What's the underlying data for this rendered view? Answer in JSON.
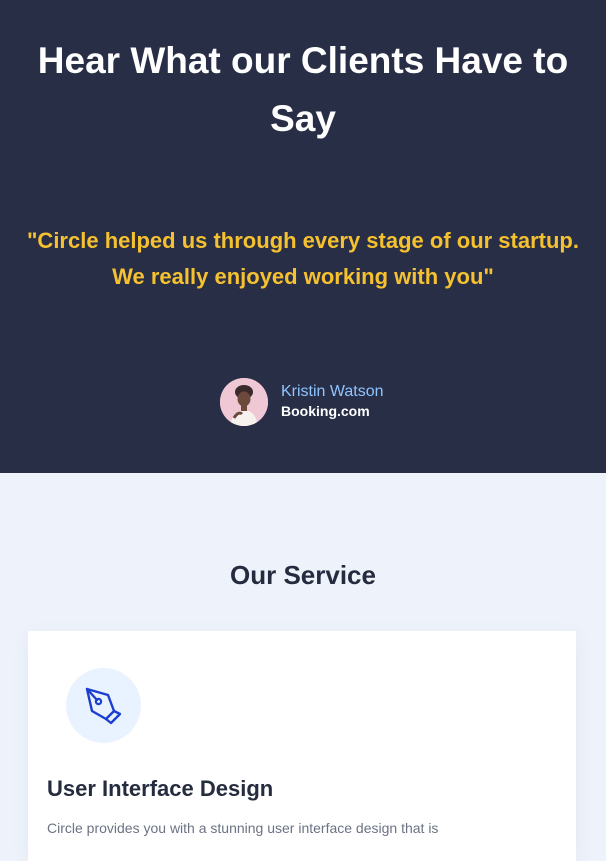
{
  "testimonial": {
    "heading": "Hear What our Clients Have to Say",
    "quote": "\"Circle helped us through every stage of our startup. We really enjoyed working with you\"",
    "author": {
      "name": "Kristin Watson",
      "company": "Booking.com"
    }
  },
  "services": {
    "heading": "Our Service",
    "items": [
      {
        "icon": "pen-tool-icon",
        "title": "User Interface Design",
        "description": "Circle provides you with a stunning user interface design that is"
      }
    ]
  },
  "colors": {
    "hero_background": "#282e46",
    "quote_yellow": "#f6c12f",
    "author_name_blue": "#8fc5ff",
    "page_background": "#eef3fb",
    "icon_blue": "#1d3fd0"
  }
}
